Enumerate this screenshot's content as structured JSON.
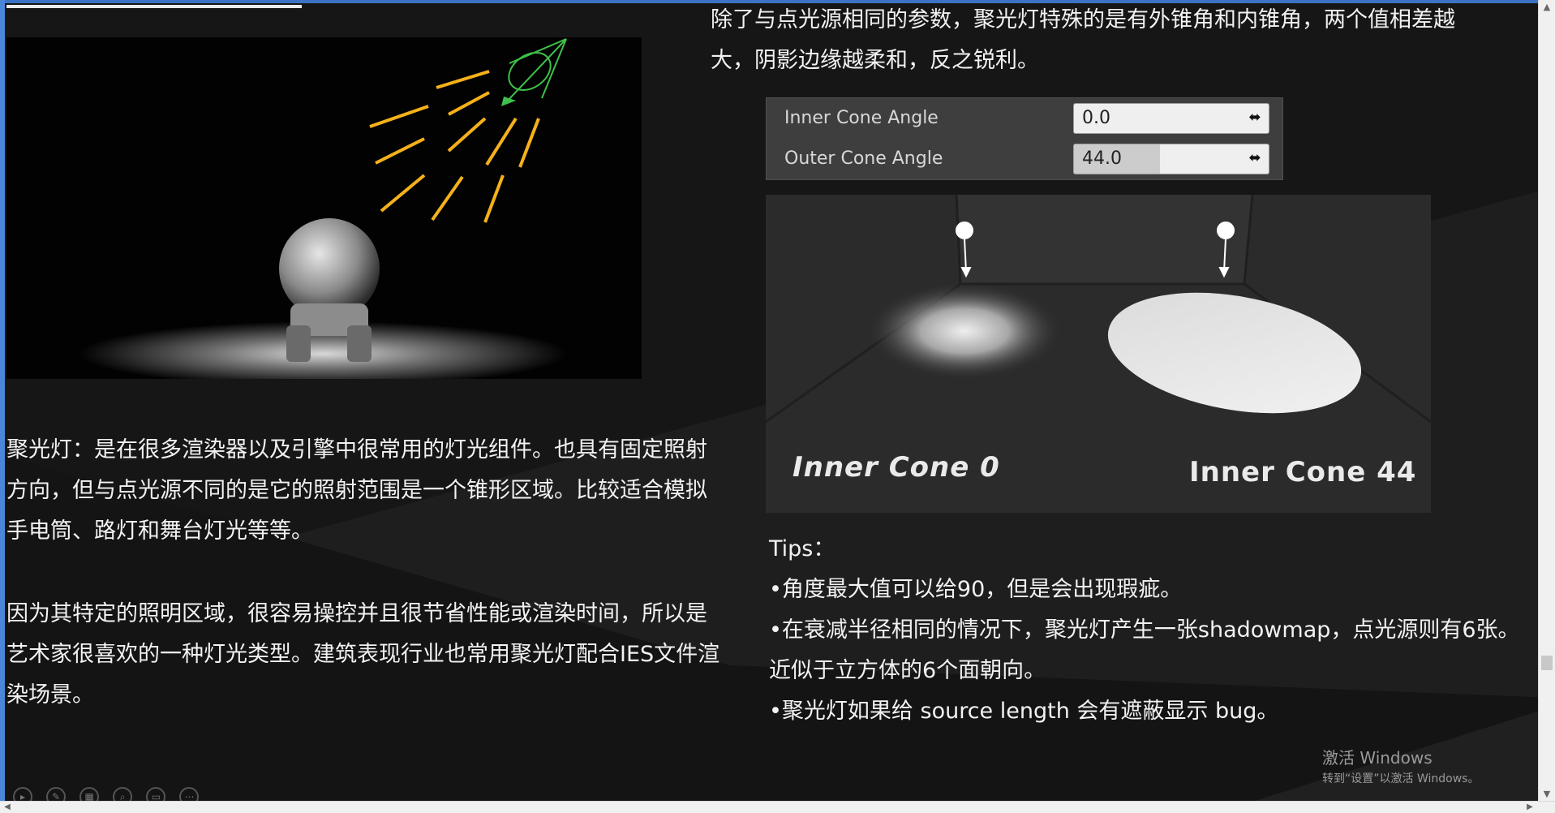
{
  "slide": {
    "left_paragraph_1": "聚光灯：是在很多渲染器以及引擎中很常用的灯光组件。也具有固定照射方向，但与点光源不同的是它的照射范围是一个锥形区域。比较适合模拟手电筒、路灯和舞台灯光等等。",
    "left_paragraph_2": "因为其特定的照明区域，很容易操控并且很节省性能或渲染时间，所以是艺术家很喜欢的一种灯光类型。建筑表现行业也常用聚光灯配合IES文件渲染场景。",
    "right_intro": "除了与点光源相同的参数，聚光灯特殊的是有外锥角和内锥角，两个值相差越大，阴影边缘越柔和，反之锐利。",
    "properties": [
      {
        "label": "Inner Cone Angle",
        "value": "0.0",
        "fill_fraction": 0.0
      },
      {
        "label": "Outer Cone Angle",
        "value": "44.0",
        "fill_fraction": 0.44
      }
    ],
    "image_labels": {
      "left": "Inner Cone 0",
      "right": "Inner Cone 44"
    },
    "tips": {
      "title": "Tips：",
      "items": [
        "•角度最大值可以给90，但是会出现瑕疵。",
        "•在衰减半径相同的情况下，聚光灯产生一张shadowmap，点光源则有6张。",
        "近似于立方体的6个面朝向。",
        "•聚光灯如果给 source length 会有遮蔽显示 bug。"
      ]
    }
  },
  "watermark": {
    "title": "激活 Windows",
    "subtitle": "转到“设置”以激活 Windows。"
  },
  "toolbar": {
    "icons": [
      "play-icon",
      "pen-icon",
      "slides-icon",
      "zoom-icon",
      "subtitle-icon",
      "more-icon"
    ]
  },
  "colors": {
    "background": "#161616",
    "accent_frame": "#3b73c6",
    "arrow": "#f5b11a",
    "cone": "#3ec14a"
  }
}
